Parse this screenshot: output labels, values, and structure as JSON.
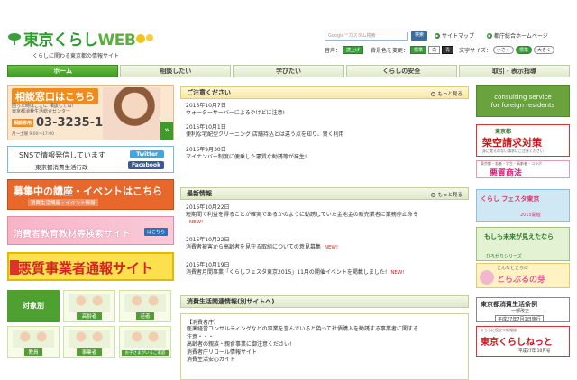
{
  "header": {
    "logo_main": "東京くらし",
    "logo_web": "WEB",
    "logo_sub": "くらしに関わる東京都の情報サイト",
    "search_placeholder": "Google™カスタム検索",
    "search_button": "検索",
    "sitemap": "サイトマップ",
    "tokyo_home": "都庁総合ホームページ",
    "voice_label": "音声：",
    "voice_button": "読上げ",
    "bg_color_label": "背景色を変更：",
    "bg_standard": "標準",
    "bg_white": "白",
    "bg_blue": "青",
    "font_size_label": "文字サイズ：",
    "font_small": "小さく",
    "font_standard": "標準",
    "font_large": "大きく"
  },
  "nav": [
    "ホーム",
    "相談したい",
    "学びたい",
    "くらしの安全",
    "取引・表示指導"
  ],
  "left": {
    "soudan_title": "相談窓口はこちら",
    "soudan_sub1": "困った時はここに 相談してね！",
    "soudan_sub2": "東京都消費生活総合センター",
    "soudan_tel_label": "相談専用",
    "soudan_tel": "03-3235-1155",
    "soudan_hours": "月〜土曜 9:00〜17:00",
    "sns_line1": "SNSで情報発信しています",
    "sns_line2": "東京都消費生活行政",
    "twitter": "Twitter",
    "facebook": "Facebook",
    "course_title": "募集中の講座・イベントはこちら",
    "course_sub": "消費生活講座・イベント情報",
    "kyozai_title": "消費者教育教材等検索サイト",
    "kyozai_btn": "はこちら",
    "report_title": "悪質事業者通報サイト",
    "taishobetsu": "対象別",
    "tiles": [
      "高齢者",
      "若者",
      "教員",
      "事業者",
      "お子さまがいるご家庭"
    ]
  },
  "center": {
    "caution_title": "ご注意ください",
    "more": "もっと見る",
    "caution_items": [
      {
        "date": "2015年10月7日",
        "text": "ウォーターサーバーによるやけどに注意!"
      },
      {
        "date": "2015年10月1日",
        "text": "便利な宅配型クリーニング 店舗持込とは違う点を知り、賢く利用"
      },
      {
        "date": "2015年9月30日",
        "text": "マイナンバー制度に便乗した悪質な勧誘等が発生!"
      }
    ],
    "latest_title": "最新情報",
    "latest_items": [
      {
        "date": "2015年10月22日",
        "text": "短期間で利益を得ることが確実であるかのように勧誘していた金地金の販売業者に業務停止命令",
        "new": "NEW!"
      },
      {
        "date": "2015年10月22日",
        "text": "消費者被害から高齢者を見守る取組についての意見募集",
        "new": "NEW!"
      },
      {
        "date": "2015年10月19日",
        "text": "消費者月間事業「くらしフェスタ東京2015」11月の開催イベントを掲載しました!",
        "new": "NEW!"
      }
    ],
    "related_title": "消費生活関連情報(別サイトへ)",
    "related_box_title": "【消費者庁】",
    "related_lines": [
      "医薬経営コンサルティングなどの事業を営んでいると偽って社債購入を勧誘する事業者に関する",
      "注意・・・",
      "高齢者の親族・親食事業に御注意ください!",
      "消費者庁リコール情報サイト",
      "消費生活安心ガイド"
    ]
  },
  "right": {
    "foreign_l1": "consulting service",
    "foreign_l2": "for foreign residents",
    "kakuu_top": "東京都",
    "kakuu_main": "架空請求対策",
    "kakuu_sub": "身に覚えのない請求にご注意ください",
    "akutoku_top": "東京都・若者・学生・高齢者・コラボ",
    "akutoku_main": "悪質商法",
    "festa_main": "くらし フェスタ東京",
    "festa_sub": "2015開催",
    "moshi_main": "もしも未来が見えたなら",
    "moshi_sub": "ひろがりシリーズ",
    "ijonaiko_top": "こんなところに",
    "ijonaiko_main": "とらぶるの芽",
    "jorei_main": "東京都消費生活条例",
    "jorei_sub": "一部改正",
    "jorei_date": "平成27年7月1日施行",
    "kurashinet_top": "くらしに役立つ情報誌",
    "kurashinet_main": "東京くらしねっと",
    "kurashinet_sub": "平成27年 10月号"
  }
}
